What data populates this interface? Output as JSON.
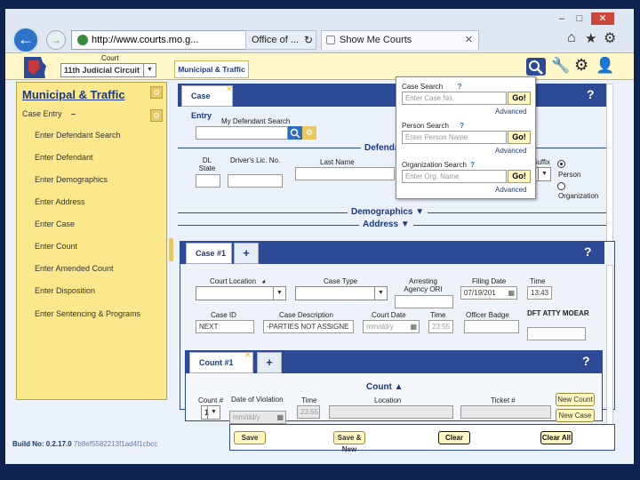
{
  "browser": {
    "url": "http://www.courts.mo.g...",
    "address_icons": "⌕ ▾ 🔒",
    "tab2_label": "Office of ...",
    "tab_reload": "↻",
    "active_tab": "Show Me Courts",
    "tab_close": "✕",
    "min": "–",
    "max": "□",
    "close": "✕",
    "home": "⌂",
    "star": "★",
    "gear": "⚙"
  },
  "header": {
    "court_label": "Court",
    "court_value": "11th Judicial Circuit",
    "module_tab": "Municipal & Traffic"
  },
  "sidebar": {
    "title": "Municipal & Traffic",
    "section": "Case Entry",
    "section_toggle": "–",
    "items": [
      "Enter Defendant Search",
      "Enter Defendant",
      "Enter Demographics",
      "Enter Address",
      "Enter Case",
      "Enter Count",
      "Enter Amended Count",
      "Enter Disposition",
      "Enter Sentencing & Programs"
    ]
  },
  "main": {
    "tab_label": "Case Entry",
    "help": "?",
    "my_defendant_search": "My Defendant Search",
    "defendant_section": "Defendant",
    "dl_state": "DL State",
    "drivers_lic": "Driver's Lic. No.",
    "last_name": "Last Name",
    "suffix": "Suffix",
    "person": "Person",
    "organization": "Organization",
    "demographics": "Demographics",
    "address": "Address"
  },
  "search_popup": {
    "case_search": "Case Search",
    "case_placeholder": "Enter Case No.",
    "person_search": "Person Search",
    "person_placeholder": "Enter Person Name",
    "org_search": "Organization Search",
    "org_placeholder": "Enter Org. Name",
    "go": "Go!",
    "advanced": "Advanced",
    "help": "?"
  },
  "case": {
    "tab": "Case #1",
    "add": "+",
    "court_location": "Court Location",
    "case_type": "Case Type",
    "arresting_agency": "Arresting Agency ORI",
    "filing_date": "Filing Date",
    "filing_date_value": "07/19/201",
    "time": "Time",
    "time_value": "13:43",
    "case_id": "Case ID",
    "case_id_value": "NEXT",
    "case_description": "Case Description",
    "case_description_value": "-PARTIES NOT ASSIGNE",
    "court_date": "Court Date",
    "court_date_placeholder": "mm/dd/y",
    "time2": "Time",
    "time2_value": "23:55",
    "officer_badge": "Officer Badge",
    "dft_atty": "DFT ATTY MOEAR"
  },
  "count": {
    "tab": "Count #1",
    "add": "+",
    "section": "Count",
    "count_num": "Count #",
    "count_num_value": "1",
    "date_of_violation": "Date of Violation",
    "date_placeholder": "mm/dd/y",
    "time": "Time",
    "time_value": "23:55",
    "location": "Location",
    "ticket": "Ticket #",
    "new_count": "New Count",
    "new_case": "New Case"
  },
  "footer": {
    "build": "Build No: 0.2.17.0",
    "hash": "7b8ef5582213f1ad4f1cbcc",
    "save": "Save",
    "save_new": "Save & New",
    "clear": "Clear",
    "clear_all": "Clear All"
  },
  "colors": {
    "navy": "#2c4a96",
    "yellow": "#fbe88c",
    "button": "#fff6c2"
  }
}
